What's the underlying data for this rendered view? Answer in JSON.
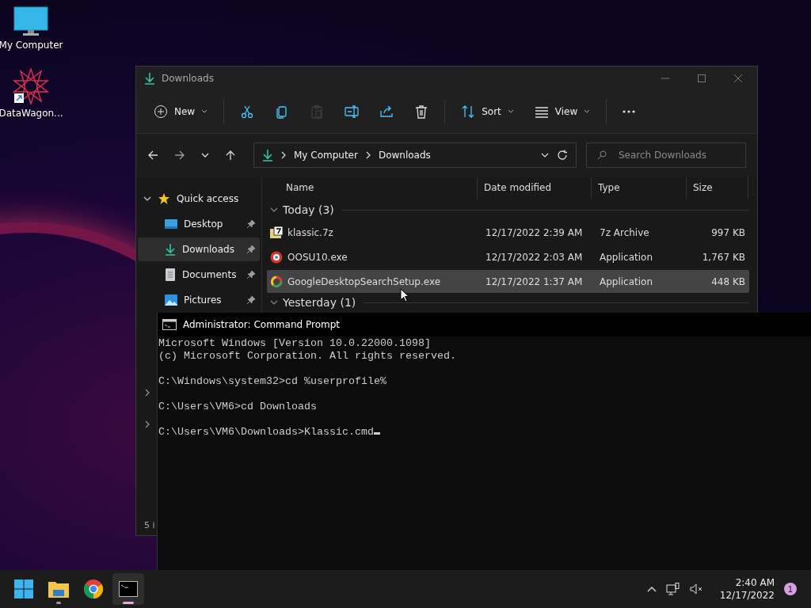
{
  "desktop_icons": [
    {
      "label": "My Computer",
      "kind": "computer"
    },
    {
      "label": "DataWagon...",
      "kind": "shortcut"
    }
  ],
  "explorer": {
    "title": "Downloads",
    "toolbar": [
      {
        "kind": "new",
        "label": "New",
        "disabled": false
      },
      {
        "kind": "cut",
        "disabled": false
      },
      {
        "kind": "copy",
        "disabled": false
      },
      {
        "kind": "paste",
        "disabled": true
      },
      {
        "kind": "rename",
        "disabled": false
      },
      {
        "kind": "share",
        "disabled": false
      },
      {
        "kind": "delete",
        "disabled": false
      },
      {
        "kind": "sort",
        "label": "Sort",
        "disabled": false
      },
      {
        "kind": "view",
        "label": "View",
        "disabled": false
      },
      {
        "kind": "more",
        "disabled": false
      }
    ],
    "breadcrumbs": [
      "My Computer",
      "Downloads"
    ],
    "search": {
      "placeholder": "Search Downloads"
    },
    "sidebar": {
      "label": "Quick access",
      "expanded": true,
      "children": [
        {
          "label": "Desktop",
          "kind": "desktop",
          "selected": false,
          "pinned": true
        },
        {
          "label": "Downloads",
          "kind": "downloads",
          "selected": true,
          "pinned": true
        },
        {
          "label": "Documents",
          "kind": "documents",
          "selected": false,
          "pinned": true
        },
        {
          "label": "Pictures",
          "kind": "pictures",
          "selected": false,
          "pinned": true
        }
      ],
      "other_nodes": [
        {
          "expanded": false
        },
        {
          "expanded": false
        }
      ]
    },
    "columns": [
      "Name",
      "Date modified",
      "Type",
      "Size"
    ],
    "groups": [
      {
        "label": "Today (3)",
        "expanded": true,
        "rows": [
          {
            "name": "klassic.7z",
            "kind": "archive",
            "date": "12/17/2022 2:39 AM",
            "type": "7z Archive",
            "size": "997 KB",
            "selected": false
          },
          {
            "name": "OOSU10.exe",
            "kind": "oosu",
            "date": "12/17/2022 2:03 AM",
            "type": "Application",
            "size": "1,767 KB",
            "selected": false
          },
          {
            "name": "GoogleDesktopSearchSetup.exe",
            "kind": "google",
            "date": "12/17/2022 1:37 AM",
            "type": "Application",
            "size": "448 KB",
            "selected": true
          }
        ]
      },
      {
        "label": "Yesterday (1)",
        "expanded": true
      }
    ],
    "status": "5 i"
  },
  "cmd": {
    "title": "Administrator: Command Prompt",
    "blocks": [
      [
        "Microsoft Windows [Version 10.0.22000.1098]",
        "(c) Microsoft Corporation. All rights reserved."
      ],
      [
        "C:\\Windows\\system32>cd %userprofile%"
      ],
      [
        "C:\\Users\\VM6>cd Downloads"
      ],
      [
        "C:\\Users\\VM6\\Downloads>Klassic.cmd"
      ]
    ]
  },
  "taskbar": {
    "apps": [
      {
        "kind": "start",
        "running": false,
        "selected": false
      },
      {
        "kind": "explorer",
        "running": true,
        "selected": false
      },
      {
        "kind": "chrome",
        "running": false,
        "selected": false
      },
      {
        "kind": "terminal",
        "running": true,
        "selected": true
      }
    ],
    "time": "2:40 AM",
    "date": "12/17/2022",
    "notifications": "1"
  }
}
